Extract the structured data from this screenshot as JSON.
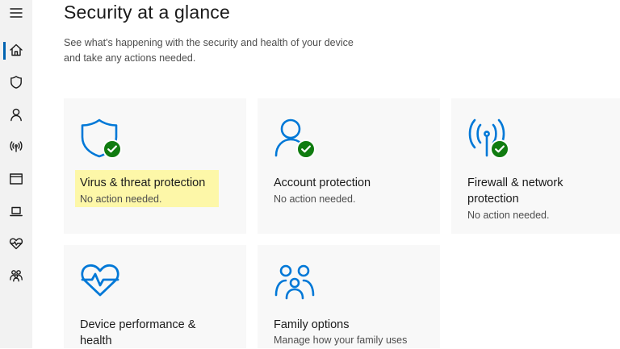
{
  "colors": {
    "accent": "#0063b1",
    "icon_blue": "#0078d7",
    "ok_green": "#107c10",
    "highlight": "#fdf7a8",
    "sidebar_bg": "#f2f2f2",
    "tile_bg": "#f8f8f8"
  },
  "sidebar": {
    "items": [
      {
        "icon": "menu-icon"
      },
      {
        "icon": "home-icon",
        "active": true
      },
      {
        "icon": "shield-icon"
      },
      {
        "icon": "person-icon"
      },
      {
        "icon": "wireless-icon"
      },
      {
        "icon": "app-browser-icon"
      },
      {
        "icon": "laptop-icon"
      },
      {
        "icon": "heart-pulse-icon"
      },
      {
        "icon": "family-icon"
      }
    ]
  },
  "header": {
    "title": "Security at a glance",
    "subtitle_line1": "See what's happening with the security and health of your device",
    "subtitle_line2": "and take any actions needed."
  },
  "tiles": [
    {
      "icon": "shield-icon",
      "title": "Virus & threat protection",
      "status": "No action needed.",
      "badge": "check-icon",
      "highlighted": true
    },
    {
      "icon": "account-icon",
      "title": "Account protection",
      "status": "No action needed.",
      "badge": "check-icon"
    },
    {
      "icon": "wireless-icon",
      "title_line1": "Firewall & network",
      "title_line2": "protection",
      "status": "No action needed.",
      "badge": "check-icon"
    },
    {
      "icon": "heart-pulse-icon",
      "title_line1": "Device performance &",
      "title_line2": "health"
    },
    {
      "icon": "family-icon",
      "title": "Family options",
      "status": "Manage how your family uses"
    }
  ]
}
